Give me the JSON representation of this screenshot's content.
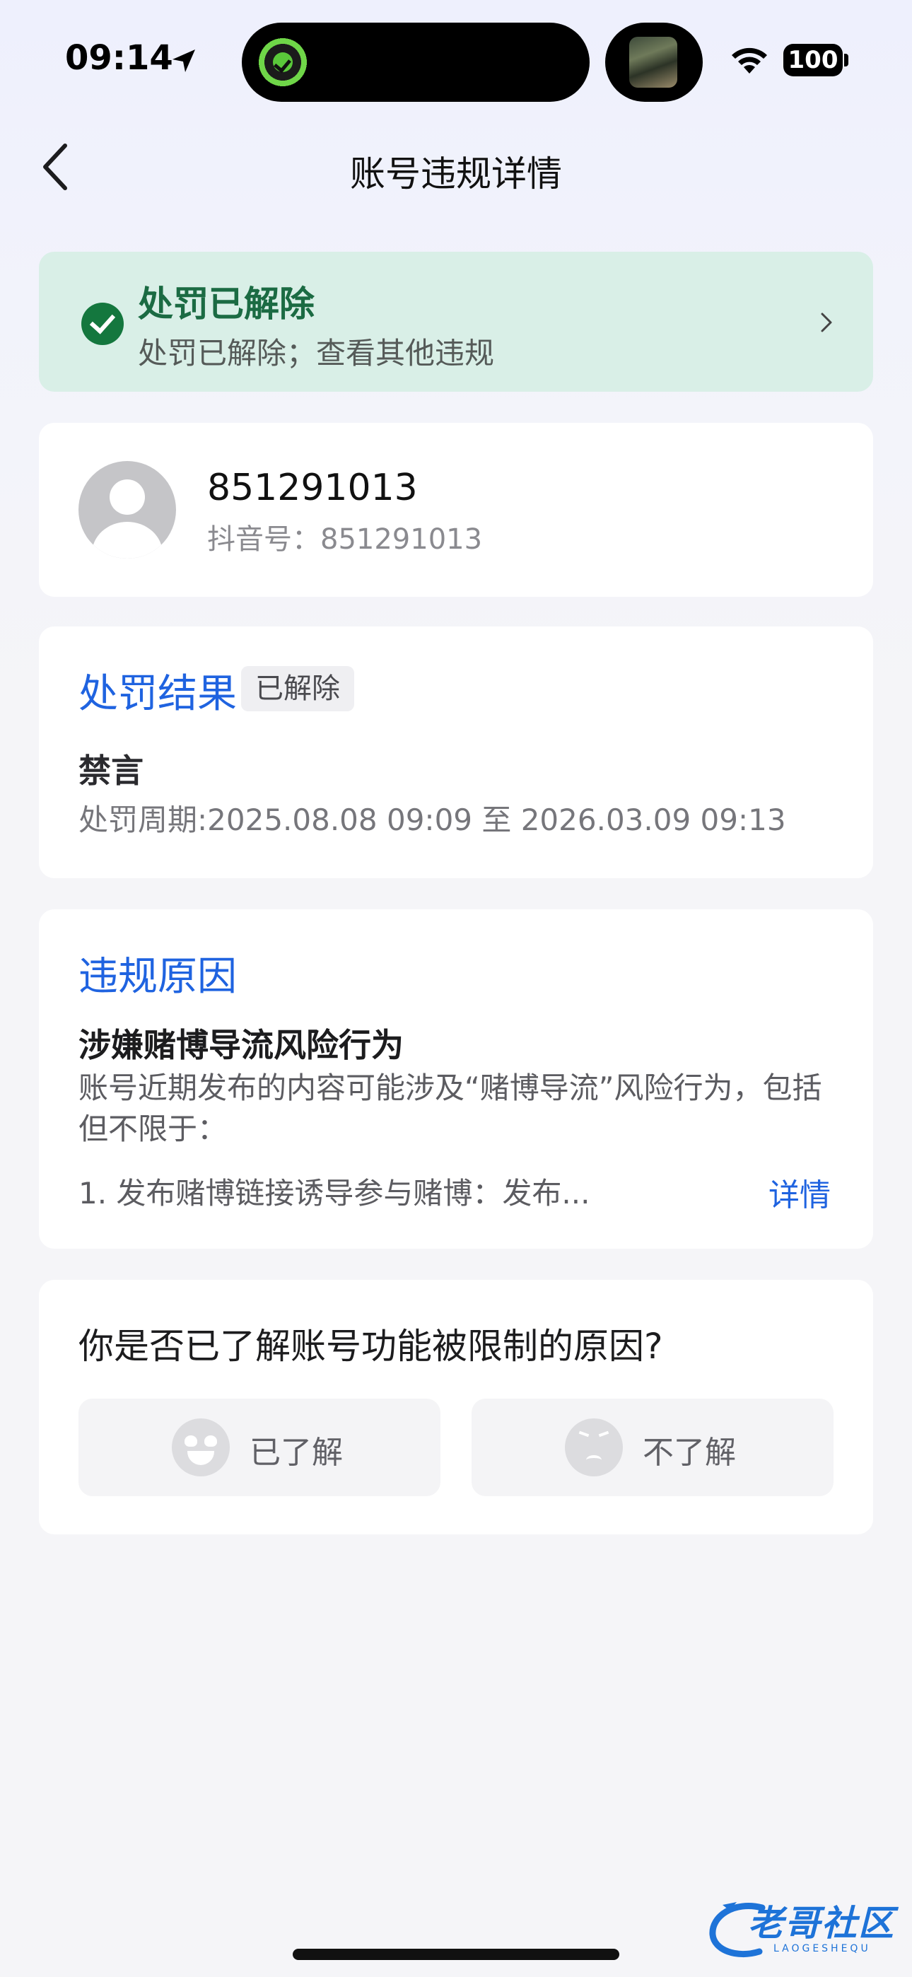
{
  "status_bar": {
    "time": "09:14",
    "battery": "100"
  },
  "header": {
    "title": "账号违规详情"
  },
  "banner": {
    "title": "处罚已解除",
    "subtitle": "处罚已解除；查看其他违规"
  },
  "profile": {
    "name": "851291013",
    "douyin_id": "抖音号：851291013"
  },
  "penalty": {
    "section_title": "处罚结果",
    "status_tag": "已解除",
    "type": "禁言",
    "period": "处罚周期:2025.08.08 09:09 至 2026.03.09 09:13"
  },
  "reason": {
    "section_title": "违规原因",
    "heading": "涉嫌赌博导流风险行为",
    "description": "账号近期发布的内容可能涉及“赌博导流”风险行为，包括但不限于：",
    "item": "1. 发布赌博链接诱导参与赌博：发布...",
    "detail_link": "详情"
  },
  "feedback": {
    "question": "你是否已了解账号功能被限制的原因?",
    "yes_label": "已了解",
    "no_label": "不了解"
  },
  "watermark": {
    "text": "老哥社区",
    "sub": "LAOGESHEQU"
  },
  "icons": {
    "back": "chevron-left-icon",
    "location": "location-arrow-icon",
    "wifi": "wifi-icon",
    "banner_check": "check-circle-icon",
    "banner_chevron": "chevron-right-icon",
    "avatar": "default-avatar-icon",
    "yes_emoji": "heart-eyes-emoji-icon",
    "no_emoji": "frown-emoji-icon"
  },
  "colors": {
    "accent_blue": "#1f63e0",
    "success_green": "#1b6b43",
    "banner_bg": "#d9efe7"
  }
}
